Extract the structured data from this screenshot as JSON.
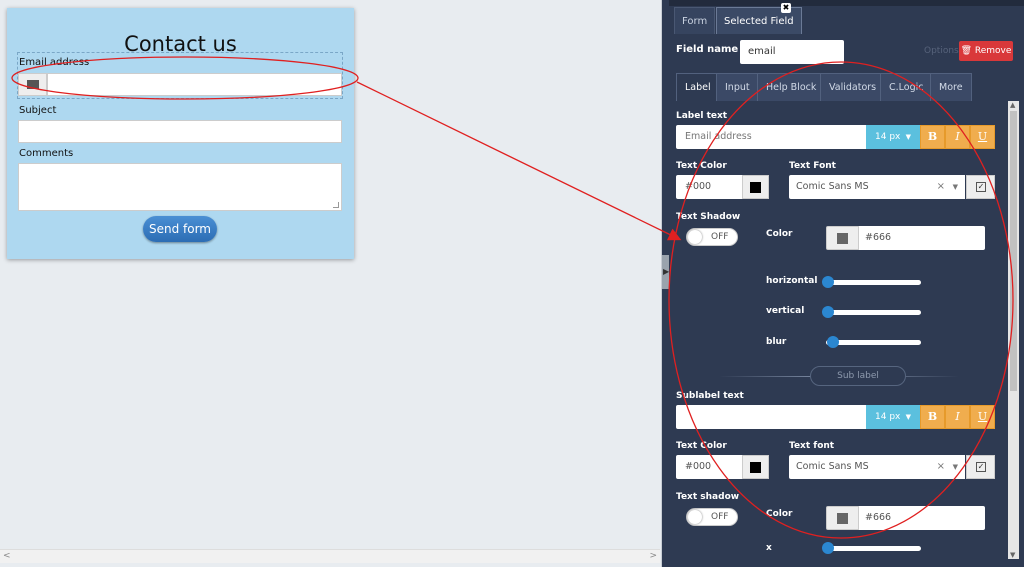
{
  "form": {
    "title": "Contact us",
    "email_label": "Email address",
    "subject_label": "Subject",
    "comments_label": "Comments",
    "send_button": "Send form"
  },
  "panel": {
    "tabs": {
      "form": "Form",
      "selected": "Selected Field"
    },
    "field_name_label": "Field name",
    "field_name_value": "email",
    "options_text": "Options",
    "remove_button": "Remove",
    "sub_tabs": [
      "Label",
      "Input",
      "Help Block",
      "Validators",
      "C.Logic",
      "More"
    ],
    "label": {
      "label_text_title": "Label text",
      "label_text_value": "Email address",
      "size": "14 px",
      "bold": "B",
      "italic": "I",
      "underline": "U",
      "text_color_title": "Text Color",
      "text_color_value": "#000",
      "text_font_title": "Text Font",
      "text_font_value": "Comic Sans MS",
      "text_shadow_title": "Text Shadow",
      "shadow_toggle": "OFF",
      "shadow_color_title": "Color",
      "shadow_color_value": "#666",
      "horizontal": "horizontal",
      "vertical": "vertical",
      "blur": "blur",
      "slider_levels": {
        "horizontal": 0,
        "vertical": 0,
        "blur": 0.05
      }
    },
    "sublabel_pill": "Sub label",
    "sublabel": {
      "sublabel_text_title": "Sublabel text",
      "sublabel_text_value": "",
      "size": "14 px",
      "bold": "B",
      "italic": "I",
      "underline": "U",
      "text_color_title": "Text Color",
      "text_color_value": "#000",
      "text_font_title": "Text font",
      "text_font_value": "Comic Sans MS",
      "text_shadow_title": "Text shadow",
      "shadow_toggle": "OFF",
      "shadow_color_title": "Color",
      "shadow_color_value": "#666",
      "x_label": "x",
      "slider_level_x": 0
    }
  },
  "colors": {
    "panel_bg": "#2e3a52",
    "form_bg": "#aed8f0",
    "accent_blue": "#5bc0de",
    "format_orange": "#f0ad4e",
    "remove_red": "#d9383a",
    "annotation_red": "#e02020"
  }
}
